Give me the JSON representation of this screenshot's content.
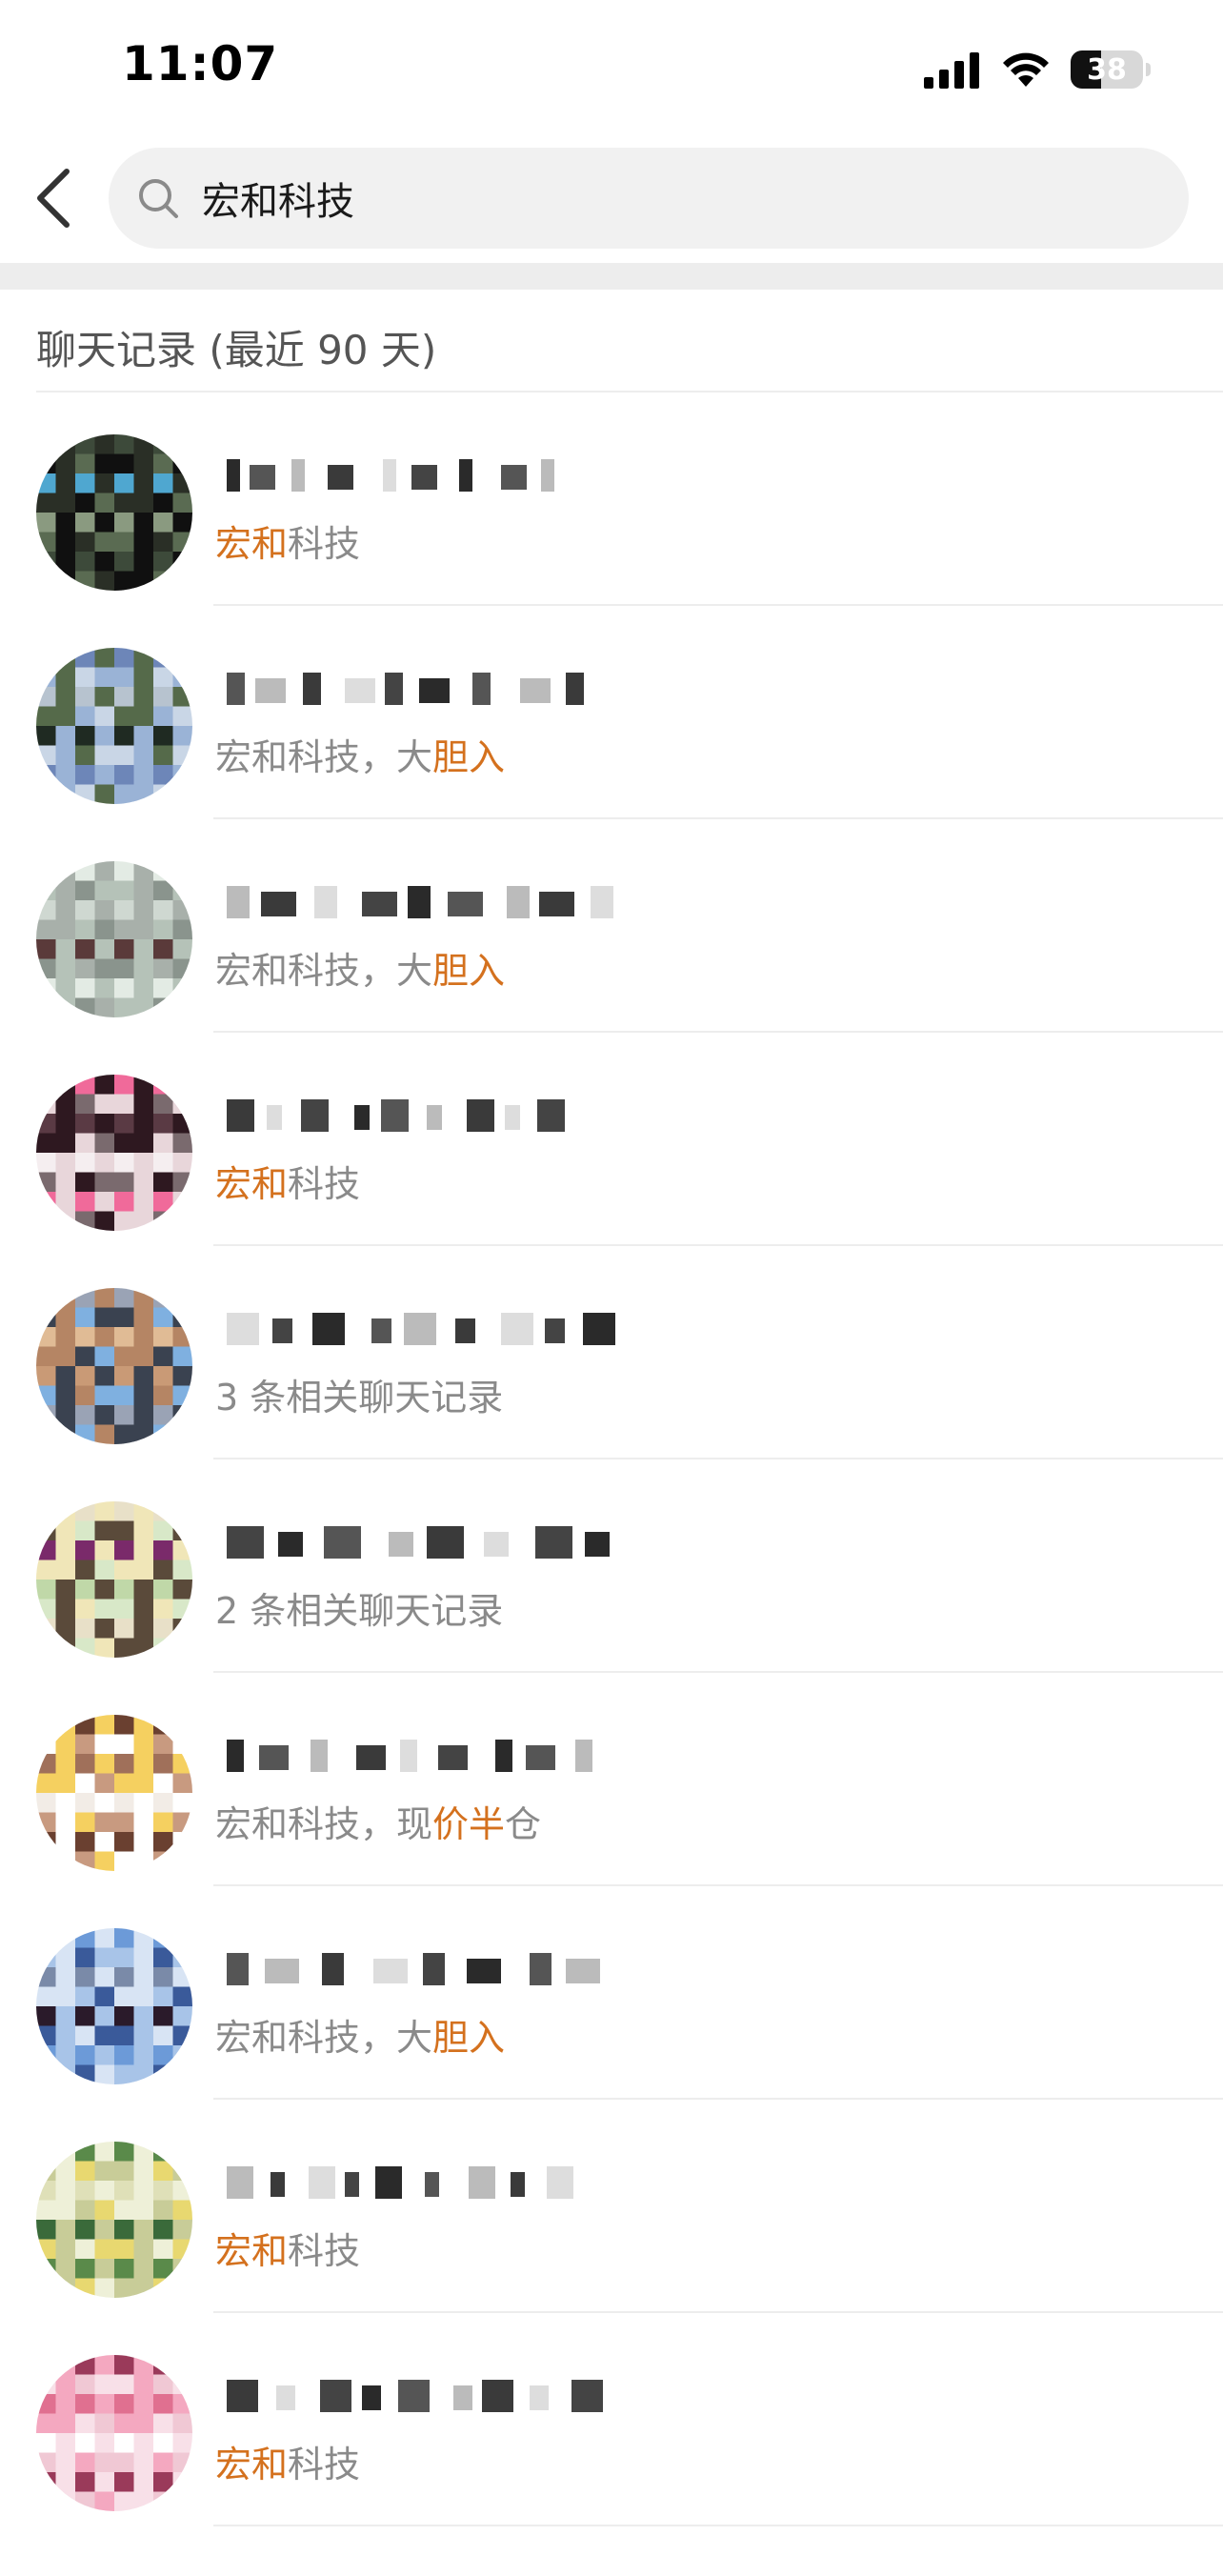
{
  "status_bar": {
    "time": "11:07",
    "battery": "38"
  },
  "search": {
    "query": "宏和科技"
  },
  "section": {
    "title": "聊天记录 (最近 90 天)"
  },
  "accent_color": "#d4711e",
  "results": [
    {
      "snippet_hl": "宏和",
      "snippet_rest": "科技",
      "pre": "",
      "avatar_colors": [
        "#3d4a3a",
        "#5a6b52",
        "#8a9a80",
        "#2a2f26",
        "#4fa7d0",
        "#101010"
      ]
    },
    {
      "pre": "宏和科技，大",
      "snippet_hl": "胆入",
      "snippet_rest": "",
      "avatar_colors": [
        "#9ab3d6",
        "#6d86b8",
        "#c9d6e6",
        "#1f2a22",
        "#556a4a",
        "#b7c3cf"
      ]
    },
    {
      "pre": "宏和科技，大",
      "snippet_hl": "胆入",
      "snippet_rest": "",
      "avatar_colors": [
        "#cfd8d1",
        "#b5c2b8",
        "#e3ebe4",
        "#8a948d",
        "#5a3a3a",
        "#a8b0aa"
      ]
    },
    {
      "snippet_hl": "宏和",
      "snippet_rest": "科技",
      "pre": "",
      "avatar_colors": [
        "#2e1820",
        "#5a3a44",
        "#e8d6da",
        "#f06a9a",
        "#7a6a6e",
        "#f5eef0"
      ]
    },
    {
      "pre": "",
      "snippet_hl": "",
      "snippet_rest": "3 条相关聊天记录",
      "avatar_colors": [
        "#c99a76",
        "#b58564",
        "#e0bb95",
        "#3a4250",
        "#9aa3b5",
        "#7fb0e0"
      ]
    },
    {
      "pre": "",
      "snippet_hl": "",
      "snippet_rest": "2 条相关聊天记录",
      "avatar_colors": [
        "#d8e8c8",
        "#c0d8a8",
        "#f0e6b8",
        "#7a2a6a",
        "#5a4a3a",
        "#e8e0c8"
      ]
    },
    {
      "pre": "宏和科技，现",
      "snippet_hl": "价半",
      "snippet_rest": "仓",
      "avatar_colors": [
        "#6a4030",
        "#c89a80",
        "#f2ece6",
        "#f5d060",
        "#a0705a",
        "#ffffff"
      ]
    },
    {
      "pre": "宏和科技，大",
      "snippet_hl": "胆入",
      "snippet_rest": "",
      "avatar_colors": [
        "#a8c4e8",
        "#6c9ad8",
        "#3a5a9a",
        "#2a1a2a",
        "#d8e4f4",
        "#7a8aa8"
      ]
    },
    {
      "snippet_hl": "宏和",
      "snippet_rest": "科技",
      "pre": "",
      "avatar_colors": [
        "#dfe0b8",
        "#c8cc98",
        "#5a8a4a",
        "#e8d870",
        "#3a6a3a",
        "#eef0d8"
      ]
    },
    {
      "snippet_hl": "宏和",
      "snippet_rest": "科技",
      "pre": "",
      "avatar_colors": [
        "#f4a8c0",
        "#e07090",
        "#f8e0e8",
        "#9a3a5a",
        "#f0c8d4",
        "#ffffff"
      ]
    }
  ]
}
